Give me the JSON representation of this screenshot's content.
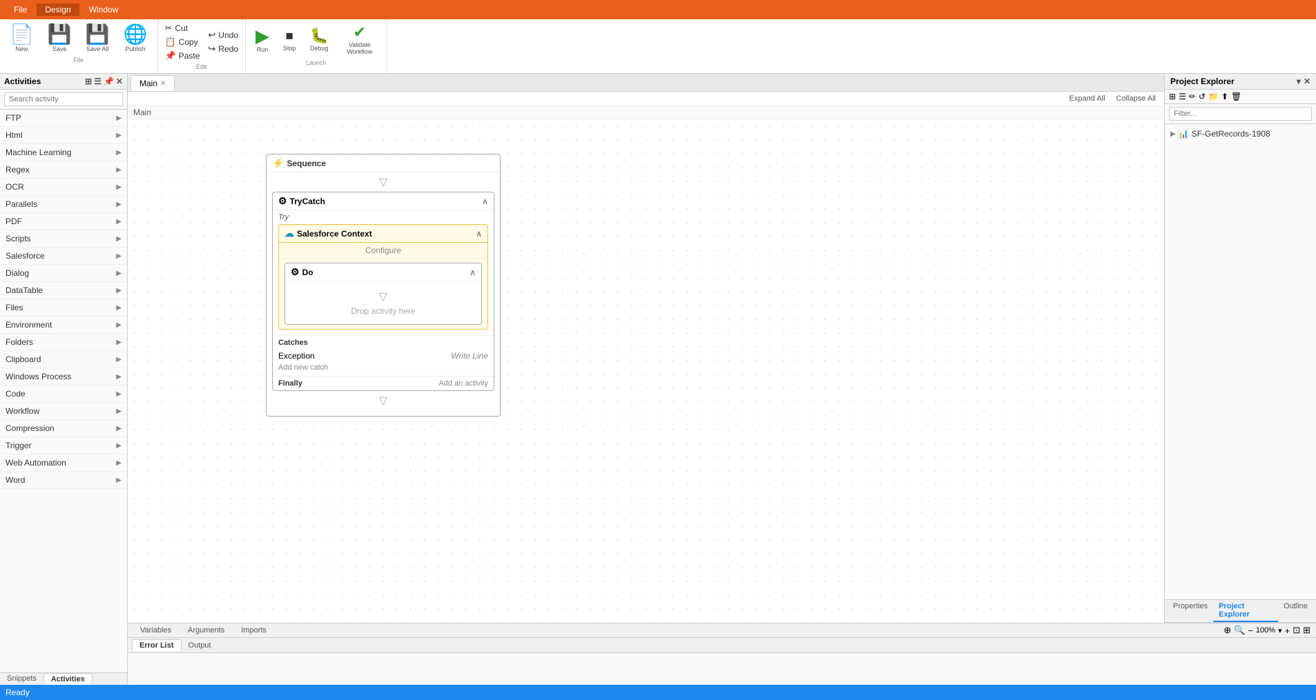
{
  "titlebar": {
    "tabs": [
      {
        "label": "File",
        "active": false
      },
      {
        "label": "Design",
        "active": true
      },
      {
        "label": "Window",
        "active": false
      }
    ]
  },
  "ribbon": {
    "file_group": {
      "label": "File",
      "buttons": [
        {
          "id": "new",
          "icon": "📄",
          "label": "New"
        },
        {
          "id": "save",
          "icon": "💾",
          "label": "Save"
        },
        {
          "id": "save-all",
          "icon": "💾",
          "label": "Save All"
        },
        {
          "id": "publish",
          "icon": "🌐",
          "label": "Publish"
        }
      ]
    },
    "edit_group": {
      "label": "Edit",
      "items": [
        {
          "id": "cut",
          "icon": "✂",
          "label": "Cut"
        },
        {
          "id": "undo",
          "icon": "↩",
          "label": "Undo"
        },
        {
          "id": "copy",
          "icon": "📋",
          "label": "Copy"
        },
        {
          "id": "redo",
          "icon": "↪",
          "label": "Redo"
        },
        {
          "id": "paste",
          "icon": "📌",
          "label": "Paste"
        }
      ]
    },
    "launch_group": {
      "label": "Launch",
      "buttons": [
        {
          "id": "run",
          "icon": "▶",
          "label": "Run"
        },
        {
          "id": "stop",
          "icon": "⏹",
          "label": "Stop"
        },
        {
          "id": "debug",
          "icon": "🐛",
          "label": "Debug"
        },
        {
          "id": "validate",
          "icon": "✔",
          "label": "Validate Workflow"
        }
      ]
    }
  },
  "activities_panel": {
    "title": "Activities",
    "search_placeholder": "Search activity",
    "items": [
      {
        "label": "FTP",
        "id": "ftp"
      },
      {
        "label": "Html",
        "id": "html"
      },
      {
        "label": "Machine Learning",
        "id": "machine-learning"
      },
      {
        "label": "Regex",
        "id": "regex"
      },
      {
        "label": "OCR",
        "id": "ocr"
      },
      {
        "label": "Parallels",
        "id": "parallels"
      },
      {
        "label": "PDF",
        "id": "pdf"
      },
      {
        "label": "Scripts",
        "id": "scripts"
      },
      {
        "label": "Salesforce",
        "id": "salesforce"
      },
      {
        "label": "Dialog",
        "id": "dialog"
      },
      {
        "label": "DataTable",
        "id": "datatable"
      },
      {
        "label": "Files",
        "id": "files"
      },
      {
        "label": "Environment",
        "id": "environment"
      },
      {
        "label": "Folders",
        "id": "folders"
      },
      {
        "label": "Clipboard",
        "id": "clipboard"
      },
      {
        "label": "Windows Process",
        "id": "windows-process"
      },
      {
        "label": "Code",
        "id": "code"
      },
      {
        "label": "Workflow",
        "id": "workflow"
      },
      {
        "label": "Compression",
        "id": "compression"
      },
      {
        "label": "Trigger",
        "id": "trigger"
      },
      {
        "label": "Web Automation",
        "id": "web-automation"
      },
      {
        "label": "Word",
        "id": "word"
      }
    ]
  },
  "tabs": [
    {
      "label": "Main",
      "active": true,
      "closeable": true
    }
  ],
  "canvas": {
    "breadcrumb": "Main",
    "toolbar": {
      "expand_all": "Expand All",
      "collapse_all": "Collapse All"
    },
    "sequence": {
      "label": "Sequence",
      "trycatch": {
        "label": "TryCatch",
        "try_label": "Try",
        "salesforce_context": {
          "label": "Salesforce Context",
          "configure_label": "Configure",
          "do_block": {
            "label": "Do",
            "drop_label": "Drop activity here"
          }
        },
        "catches": {
          "label": "Catches",
          "exception_label": "Exception",
          "write_line": "Write Line",
          "add_catch": "Add new catch"
        },
        "finally": {
          "label": "Finally",
          "add_activity": "Add an activity"
        }
      }
    }
  },
  "right_panel": {
    "title": "Project Explorer",
    "filter_placeholder": "Filter...",
    "tabs": [
      {
        "label": "Properties",
        "active": false
      },
      {
        "label": "Project Explorer",
        "active": true
      },
      {
        "label": "Outline",
        "active": false
      }
    ],
    "tree": [
      {
        "label": "SF-GetRecords-1908",
        "icon": "📁",
        "indent": 1
      }
    ]
  },
  "bottom": {
    "tabs": [
      {
        "label": "Snippets",
        "active": false
      },
      {
        "label": "Activities",
        "active": true
      }
    ],
    "editor_tabs": [
      {
        "label": "Variables",
        "active": false
      },
      {
        "label": "Arguments",
        "active": false
      },
      {
        "label": "Imports",
        "active": false
      }
    ],
    "bottom_panel_tabs": [
      {
        "label": "Error List",
        "active": true
      },
      {
        "label": "Output",
        "active": false
      }
    ]
  },
  "status": {
    "text": "Ready",
    "zoom": "100%"
  }
}
